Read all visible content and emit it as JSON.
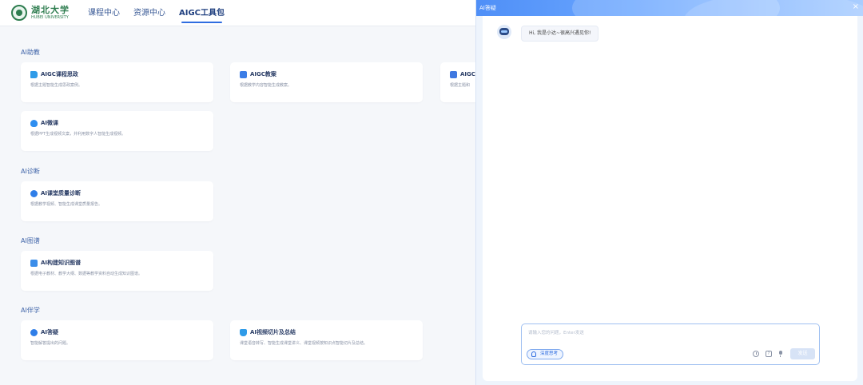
{
  "header": {
    "logo": {
      "name": "湖北大学",
      "subtitle": "HUBEI UNIVERSITY"
    },
    "tabs": [
      {
        "label": "课程中心"
      },
      {
        "label": "资源中心"
      },
      {
        "label": "AIGC工具包",
        "active": true
      }
    ]
  },
  "sections": [
    {
      "title": "AI助教",
      "cards": [
        {
          "title": "AIGC课程思政",
          "desc": "根据主题智能生成思政案例。",
          "icon": "flag-icon",
          "color": "#2f9be8"
        },
        {
          "title": "AIGC教案",
          "desc": "根据教学内容智能生成教案。",
          "icon": "book-icon",
          "color": "#3b7de6"
        },
        {
          "title": "AIGC",
          "desc": "根据主题和",
          "icon": "edit-doc-icon",
          "color": "#3f78e0"
        },
        {
          "title": "AI微课",
          "desc": "根据PPT生成视频文案，并利用数字人智能生成视频。",
          "icon": "flame-icon",
          "color": "#2e8ef0"
        }
      ]
    },
    {
      "title": "AI诊断",
      "cards": [
        {
          "title": "AI课堂质量诊断",
          "desc": "根据教学视频、智能生成课堂质量报告。",
          "icon": "diagnosis-icon",
          "color": "#2f7ee8"
        }
      ]
    },
    {
      "title": "AI图谱",
      "cards": [
        {
          "title": "AI构建知识图谱",
          "desc": "根据电子教材、教学大纲、数据等教学资料自动生成知识图谱。",
          "icon": "graph-icon",
          "color": "#3b8de9"
        }
      ]
    },
    {
      "title": "AI伴学",
      "cards": [
        {
          "title": "AI答疑",
          "desc": "智能解答提出的问题。",
          "icon": "question-icon",
          "color": "#2f7ee8"
        },
        {
          "title": "AI视频切片及总结",
          "desc": "课堂语音转写、智能生成课堂讲义、课堂视频按知识点智能切片及总结。",
          "icon": "graduation-cap-icon",
          "color": "#2f9be8"
        }
      ]
    }
  ],
  "chat": {
    "title": "AI答疑",
    "close": "×",
    "greeting": "Hi, 我是小达~很高兴遇见你!",
    "input_placeholder": "请输入您的问题，Enter发送",
    "deep_think_label": "深度思考",
    "help_label": "?",
    "send_label": "发送"
  }
}
